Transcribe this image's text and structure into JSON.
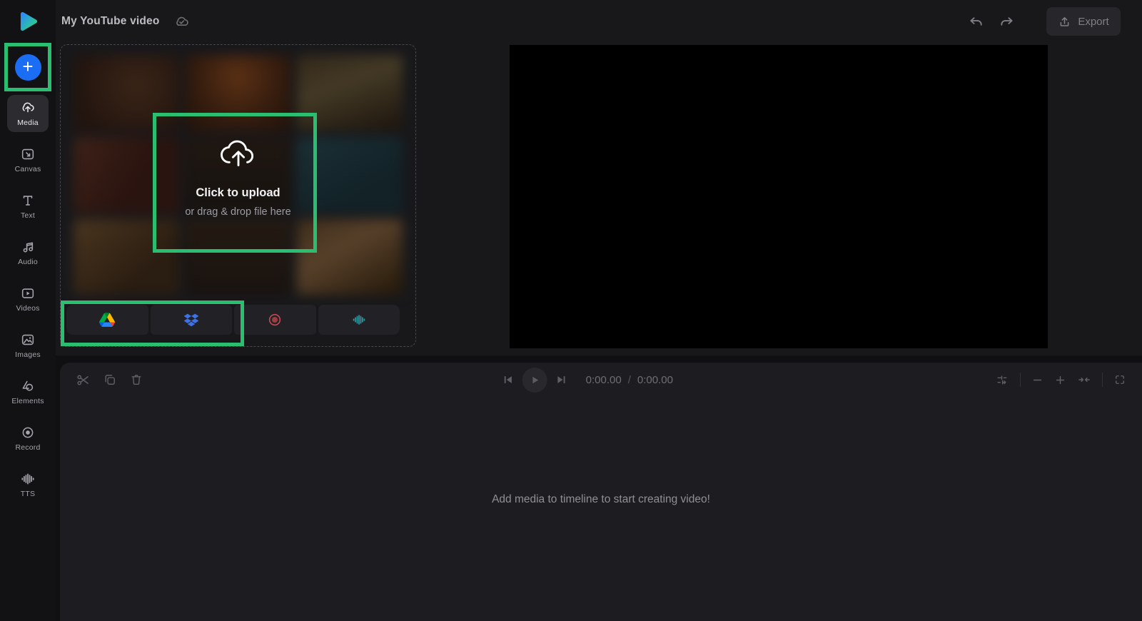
{
  "topbar": {
    "title": "My YouTube video",
    "export_label": "Export"
  },
  "sidebar": {
    "add_button_label": "+",
    "items": [
      {
        "label": "Media",
        "icon": "cloud-upload-icon",
        "active": true
      },
      {
        "label": "Canvas",
        "icon": "canvas-icon",
        "active": false
      },
      {
        "label": "Text",
        "icon": "text-icon",
        "active": false
      },
      {
        "label": "Audio",
        "icon": "audio-note-icon",
        "active": false
      },
      {
        "label": "Videos",
        "icon": "video-icon",
        "active": false
      },
      {
        "label": "Images",
        "icon": "image-icon",
        "active": false
      },
      {
        "label": "Elements",
        "icon": "elements-icon",
        "active": false
      },
      {
        "label": "Record",
        "icon": "record-icon",
        "active": false
      },
      {
        "label": "TTS",
        "icon": "waveform-icon",
        "active": false
      }
    ]
  },
  "media_panel": {
    "upload_title": "Click to upload",
    "upload_subtitle": "or drag & drop file here",
    "source_buttons": [
      "google-drive",
      "dropbox",
      "screen-record",
      "audio-waveform"
    ]
  },
  "timeline": {
    "current_time": "0:00.00",
    "time_separator": "/",
    "total_time": "0:00.00",
    "empty_message": "Add media to timeline to start creating video!"
  },
  "annotations": {
    "highlight_color": "#2cbe70"
  },
  "colors": {
    "add_button_blue": "#1b6ef3",
    "record_red": "#c04a4f",
    "waveform_teal": "#2f98a2",
    "dropbox_blue": "#3d72e8",
    "preview_black": "#000000"
  }
}
